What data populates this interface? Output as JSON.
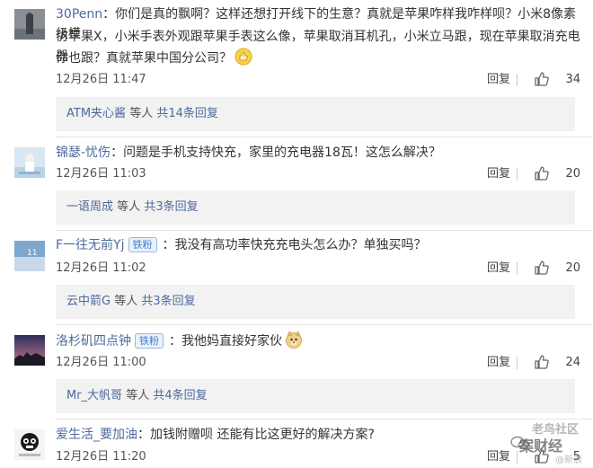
{
  "comments": [
    {
      "username": "30Penn",
      "badge": "",
      "text_line1": "你们是真的飘啊？这样还想打开线下的生意？真就是苹果咋样我咋样呗？小米8像素级模",
      "text_line2": "仿苹果X，小米手表外观跟苹果手表这么像，苹果取消耳机孔，小米立马跟，现在苹果取消充电器",
      "text_line3": "你也跟？真就苹果中国分公司？",
      "emoji": "thumbs-up-emoji",
      "timestamp": "12月26日 11:47",
      "reply_label": "回复",
      "like_count": "34",
      "sub_reply_user": "ATM夹心酱",
      "sub_reply_etc": "等人",
      "sub_reply_total": "共14条回复"
    },
    {
      "username": "锦瑟-忧伤",
      "badge": "",
      "text_line1": "问题是手机支持快充，家里的充电器18瓦！这怎么解决？",
      "timestamp": "12月26日 11:03",
      "reply_label": "回复",
      "like_count": "20",
      "sub_reply_user": "一语周成",
      "sub_reply_etc": "等人",
      "sub_reply_total": "共3条回复"
    },
    {
      "username": "F一往无前Yj",
      "badge": "铁粉",
      "text_line1": "我没有高功率快充充电头怎么办？单独买吗？",
      "timestamp": "12月26日 11:02",
      "reply_label": "回复",
      "like_count": "20",
      "sub_reply_user": "云中箭G",
      "sub_reply_etc": "等人",
      "sub_reply_total": "共3条回复"
    },
    {
      "username": "洛杉矶四点钟",
      "badge": "铁粉",
      "text_line1": "我他妈直接好家伙",
      "emoji": "doge-emoji",
      "timestamp": "12月26日 11:00",
      "reply_label": "回复",
      "like_count": "24",
      "sub_reply_user": "Mr_大帆哥",
      "sub_reply_etc": "等人",
      "sub_reply_total": "共4条回复"
    },
    {
      "username": "爱生活_要加油",
      "badge": "",
      "text_line1": "加钱附赠呗 还能有比这更好的解决方案?",
      "timestamp": "12月26日 11:20",
      "reply_label": "回复",
      "like_count": "5"
    }
  ],
  "colors": {
    "username": "#4d6a9c",
    "reply_box_bg": "#f2f2f2",
    "badge": "#3c7ad6"
  },
  "watermark": {
    "line1": "老鸟社区",
    "line2": "案财经",
    "line3": "@新浪"
  }
}
